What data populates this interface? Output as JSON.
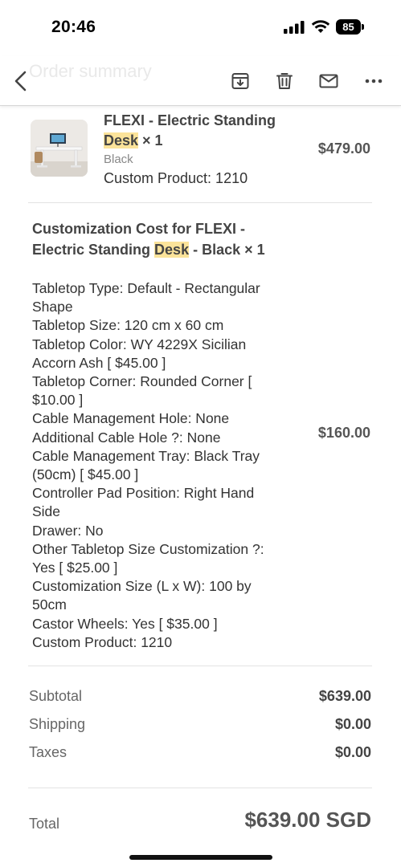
{
  "status_bar": {
    "time": "20:46",
    "battery": "85"
  },
  "toolbar": {
    "title": "Order summary",
    "icons": [
      "chevron-left-icon",
      "archive-icon",
      "trash-icon",
      "mail-icon",
      "more-horizontal-icon"
    ]
  },
  "product": {
    "title_prefix": "FLEXI - Electric Standing",
    "title_highlight": "Desk",
    "title_suffix": " × 1",
    "variant": "Black",
    "custom": "Custom Product: 1210",
    "price": "$479.00"
  },
  "customization": {
    "title_prefix": "Customization Cost for FLEXI - Electric Standing ",
    "title_highlight": "Desk",
    "title_suffix": " - Black × 1",
    "price": "$160.00",
    "lines": [
      "Tabletop Type: Default - Rectangular",
      "Shape",
      "Tabletop Size: 120 cm x 60 cm",
      "Tabletop Color: WY 4229X Sicilian",
      "Accorn Ash [ $45.00 ]",
      "Tabletop Corner: Rounded Corner [",
      "$10.00 ]",
      "Cable Management Hole: None",
      "Additional Cable Hole ?: None",
      "Cable Management Tray: Black Tray",
      "(50cm) [ $45.00 ]",
      "Controller Pad Position: Right Hand",
      "Side",
      "Drawer: No",
      "Other Tabletop Size Customization ?:",
      "Yes [ $25.00 ]",
      "Customization Size (L x W): 100 by",
      "50cm",
      "Castor Wheels: Yes [ $35.00 ]",
      "Custom Product: 1210"
    ]
  },
  "totals": {
    "subtotal_label": "Subtotal",
    "subtotal_value": "$639.00",
    "shipping_label": "Shipping",
    "shipping_value": "$0.00",
    "taxes_label": "Taxes",
    "taxes_value": "$0.00",
    "total_label": "Total",
    "total_value": "$639.00 SGD"
  },
  "colors": {
    "highlight": "#fbe39a",
    "divider": "#e3e3e3"
  }
}
